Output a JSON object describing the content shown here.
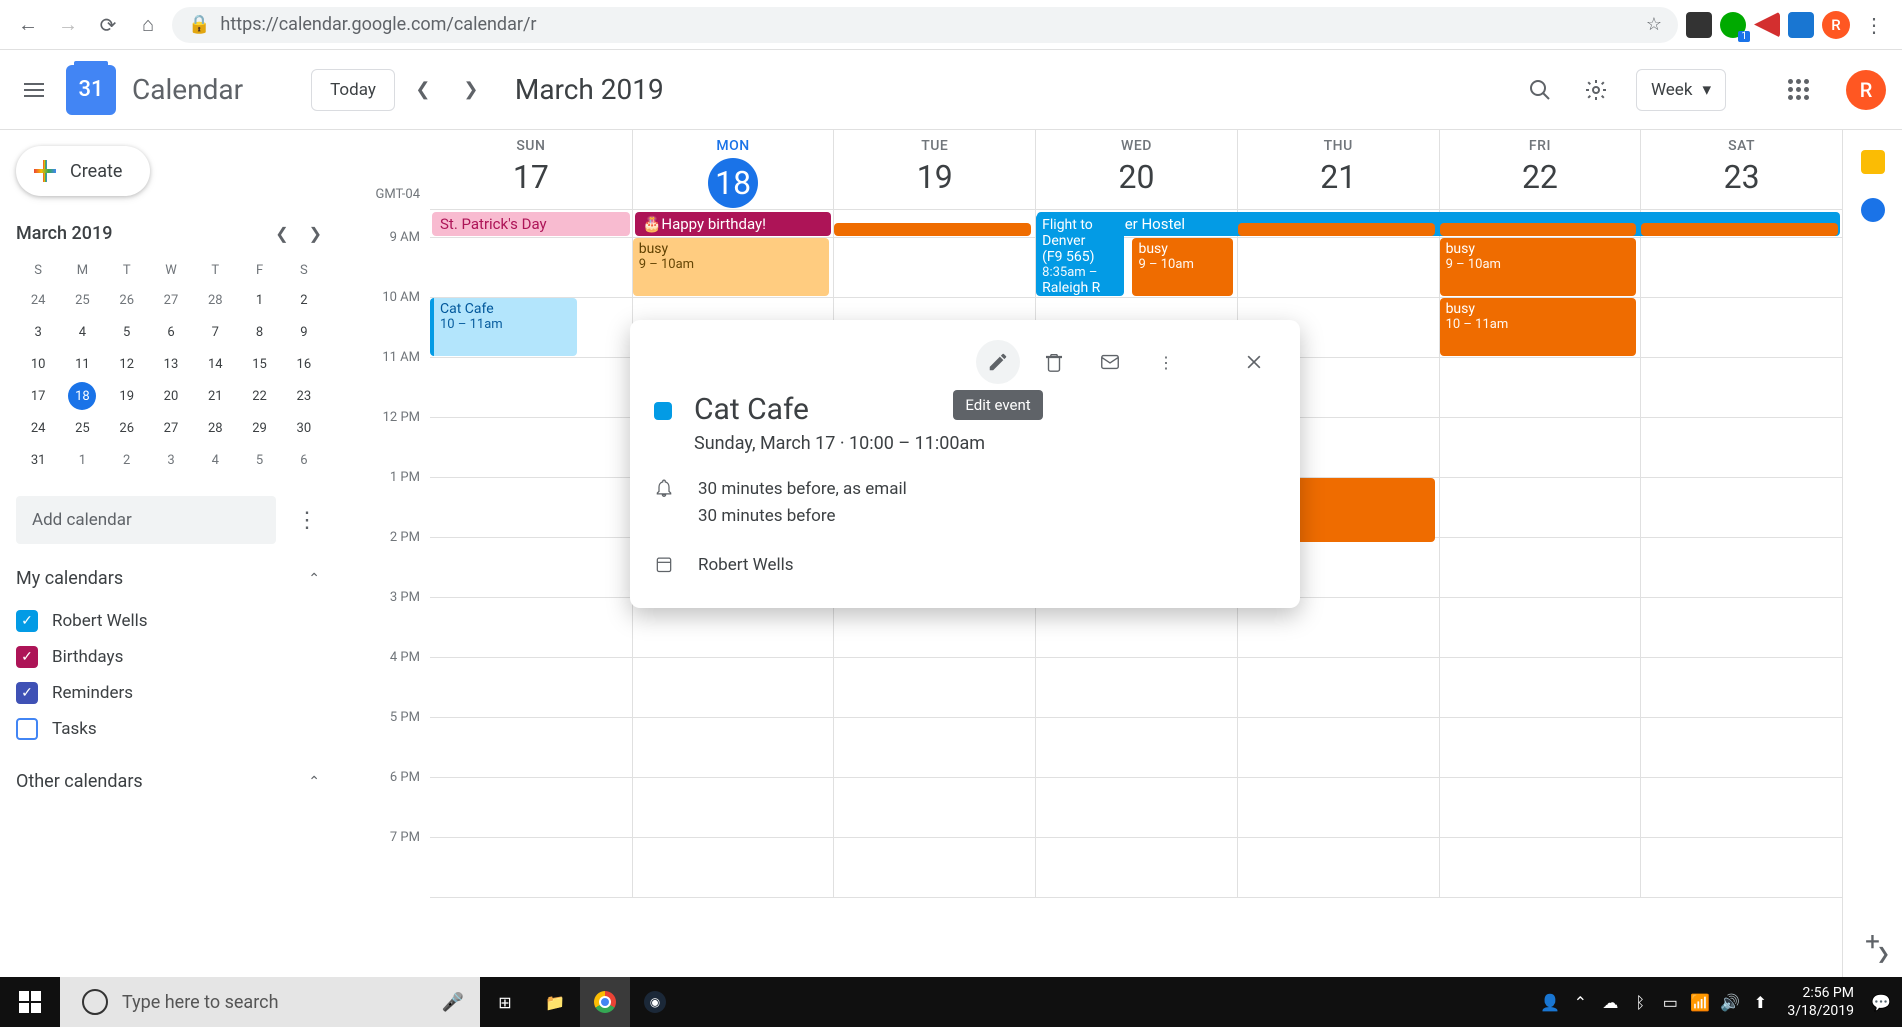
{
  "browser": {
    "url": "https://calendar.google.com/calendar/r",
    "avatar_letter": "R"
  },
  "header": {
    "logo_day": "31",
    "app_name": "Calendar",
    "today_label": "Today",
    "month_title": "March 2019",
    "view_label": "Week"
  },
  "sidebar": {
    "create_label": "Create",
    "mini_month": "March 2019",
    "dow": [
      "S",
      "M",
      "T",
      "W",
      "T",
      "F",
      "S"
    ],
    "weeks": [
      [
        {
          "n": "24",
          "dim": true
        },
        {
          "n": "25",
          "dim": true
        },
        {
          "n": "26",
          "dim": true
        },
        {
          "n": "27",
          "dim": true
        },
        {
          "n": "28",
          "dim": true
        },
        {
          "n": "1"
        },
        {
          "n": "2"
        }
      ],
      [
        {
          "n": "3"
        },
        {
          "n": "4"
        },
        {
          "n": "5"
        },
        {
          "n": "6"
        },
        {
          "n": "7"
        },
        {
          "n": "8"
        },
        {
          "n": "9"
        }
      ],
      [
        {
          "n": "10"
        },
        {
          "n": "11"
        },
        {
          "n": "12"
        },
        {
          "n": "13"
        },
        {
          "n": "14"
        },
        {
          "n": "15"
        },
        {
          "n": "16"
        }
      ],
      [
        {
          "n": "17"
        },
        {
          "n": "18",
          "today": true
        },
        {
          "n": "19"
        },
        {
          "n": "20"
        },
        {
          "n": "21"
        },
        {
          "n": "22"
        },
        {
          "n": "23"
        }
      ],
      [
        {
          "n": "24"
        },
        {
          "n": "25"
        },
        {
          "n": "26"
        },
        {
          "n": "27"
        },
        {
          "n": "28"
        },
        {
          "n": "29"
        },
        {
          "n": "30"
        }
      ],
      [
        {
          "n": "31"
        },
        {
          "n": "1",
          "dim": true
        },
        {
          "n": "2",
          "dim": true
        },
        {
          "n": "3",
          "dim": true
        },
        {
          "n": "4",
          "dim": true
        },
        {
          "n": "5",
          "dim": true
        },
        {
          "n": "6",
          "dim": true
        }
      ]
    ],
    "add_calendar_placeholder": "Add calendar",
    "my_calendars_label": "My calendars",
    "other_calendars_label": "Other calendars",
    "calendars": [
      {
        "label": "Robert Wells",
        "color": "#039be5",
        "checked": true
      },
      {
        "label": "Birthdays",
        "color": "#ad1457",
        "checked": true
      },
      {
        "label": "Reminders",
        "color": "#3f51b5",
        "checked": true
      },
      {
        "label": "Tasks",
        "color": "#4285f4",
        "checked": false
      }
    ]
  },
  "grid": {
    "timezone": "GMT-04",
    "hours": [
      "9 AM",
      "10 AM",
      "11 AM",
      "12 PM",
      "1 PM",
      "2 PM",
      "3 PM",
      "4 PM",
      "5 PM",
      "6 PM",
      "7 PM"
    ],
    "days": [
      {
        "dow": "SUN",
        "num": "17"
      },
      {
        "dow": "MON",
        "num": "18",
        "active": true
      },
      {
        "dow": "TUE",
        "num": "19"
      },
      {
        "dow": "WED",
        "num": "20"
      },
      {
        "dow": "THU",
        "num": "21"
      },
      {
        "dow": "FRI",
        "num": "22"
      },
      {
        "dow": "SAT",
        "num": "23"
      }
    ],
    "allday": {
      "patricks": "St. Patrick's Day",
      "birthday": "Happy birthday!",
      "hostel": "Stay at Ember Hostel"
    },
    "events": {
      "catcafe_title": "Cat Cafe",
      "catcafe_time": "10 – 11am",
      "busy": "busy",
      "busy_9_10": "9 – 10am",
      "busy_10_11": "10 – 11am",
      "flight_title": "Flight to Denver",
      "flight_sub": "(F9 565)",
      "flight_time": "8:35am –",
      "flight_dest": "Raleigh R"
    }
  },
  "popup": {
    "title": "Cat Cafe",
    "datetime": "Sunday, March 17  ·  10:00 – 11:00am",
    "reminder1": "30 minutes before, as email",
    "reminder2": "30 minutes before",
    "calendar": "Robert Wells",
    "edit_tooltip": "Edit event"
  },
  "taskbar": {
    "search_placeholder": "Type here to search",
    "time": "2:56 PM",
    "date": "3/18/2019"
  }
}
